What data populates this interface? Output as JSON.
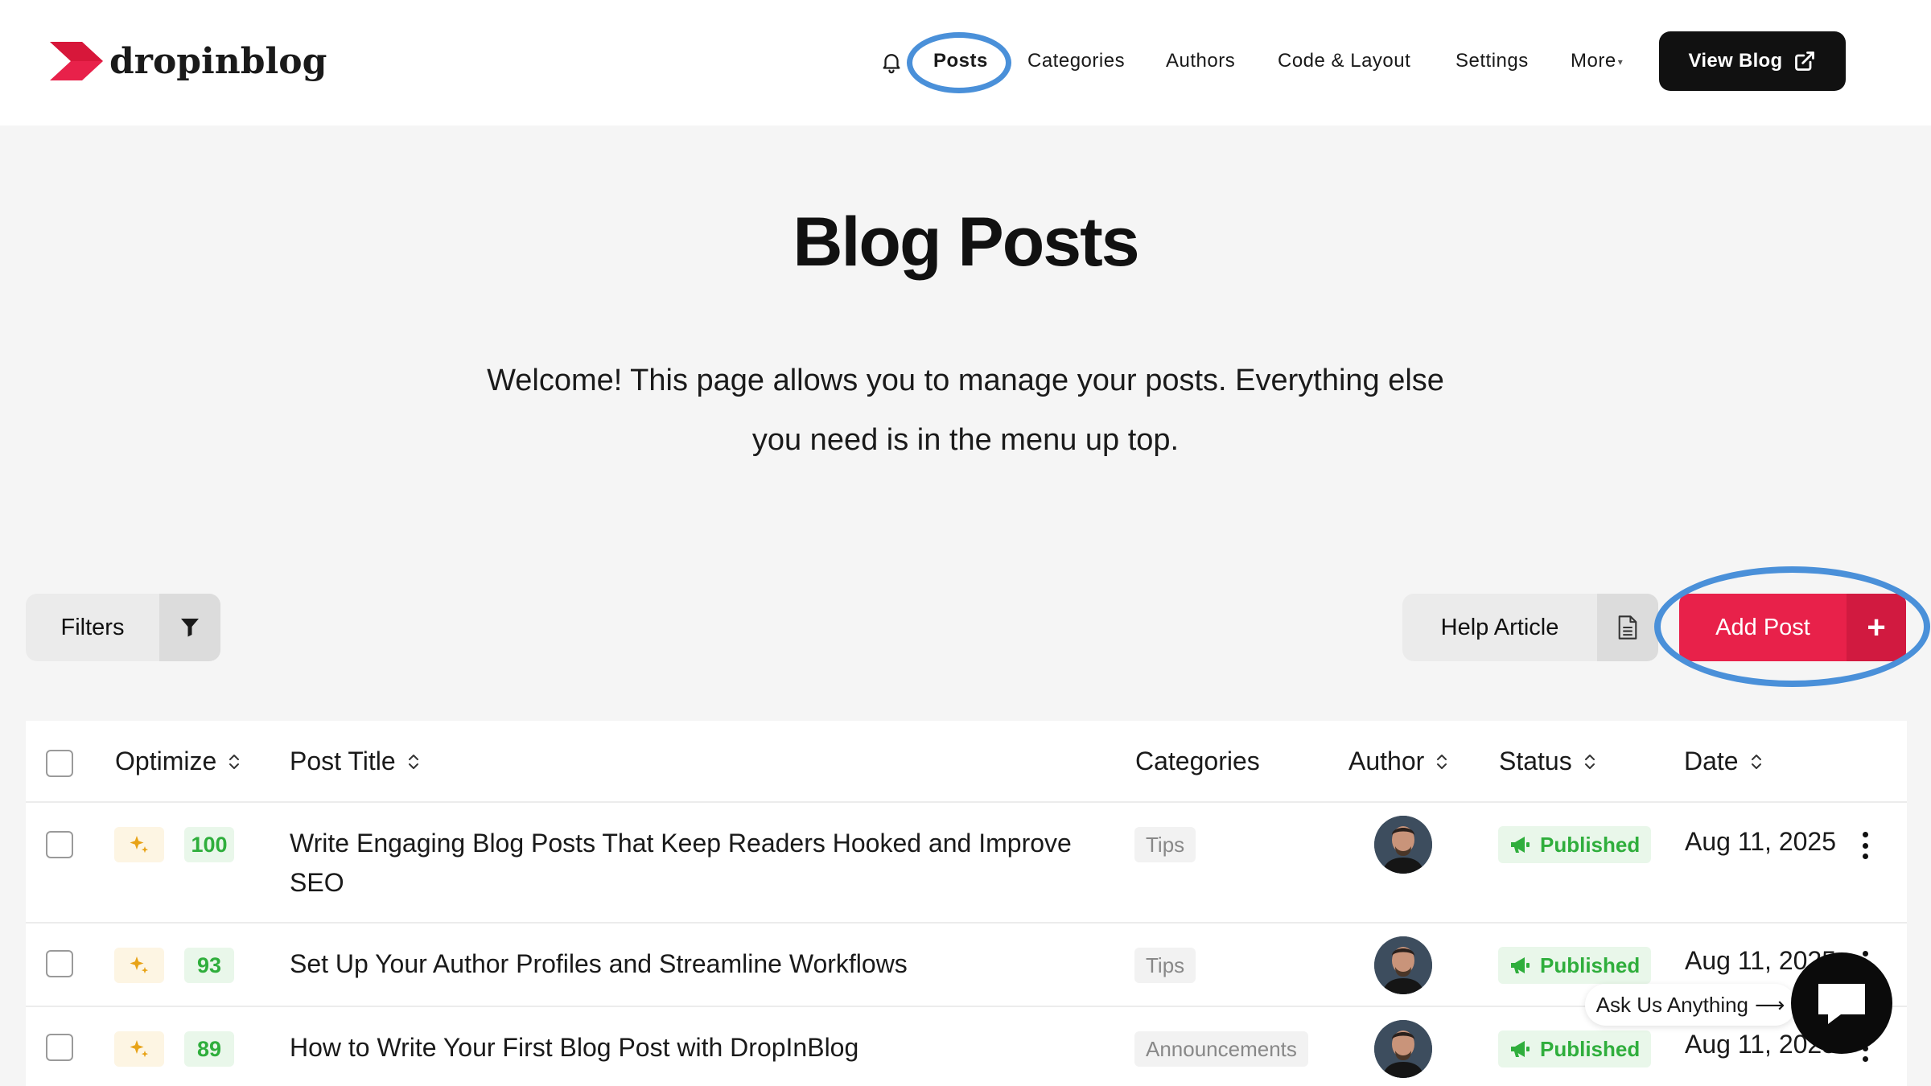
{
  "app": {
    "logo_text": "dropinblog",
    "brand_color": "#e8214a",
    "accent_ring_color": "#4a90d9"
  },
  "nav": {
    "items": [
      {
        "label": "Posts",
        "active": true
      },
      {
        "label": "Categories"
      },
      {
        "label": "Authors"
      },
      {
        "label": "Code & Layout"
      },
      {
        "label": "Settings"
      },
      {
        "label": "More"
      }
    ],
    "view_blog_label": "View Blog"
  },
  "hero": {
    "title": "Blog Posts",
    "subtitle_line1": "Welcome! This page allows you to manage your posts. Everything else",
    "subtitle_line2": "you need is in the menu up top."
  },
  "toolbar": {
    "filters_label": "Filters",
    "help_label": "Help Article",
    "add_post_label": "Add Post"
  },
  "table": {
    "columns": [
      "Optimize",
      "Post Title",
      "Categories",
      "Author",
      "Status",
      "Date"
    ],
    "rows": [
      {
        "score": "100",
        "title": "Write Engaging Blog Posts That Keep Readers Hooked and Improve SEO",
        "category": "Tips",
        "status": "Published",
        "date": "Aug 11, 2025"
      },
      {
        "score": "93",
        "title": "Set Up Your Author Profiles and Streamline Workflows",
        "category": "Tips",
        "status": "Published",
        "date": "Aug 11, 2025"
      },
      {
        "score": "89",
        "title": "How to Write Your First Blog Post with DropInBlog",
        "category": "Announcements",
        "status": "Published",
        "date": "Aug 11, 2025"
      }
    ]
  },
  "chat": {
    "prompt": "Ask Us Anything"
  }
}
